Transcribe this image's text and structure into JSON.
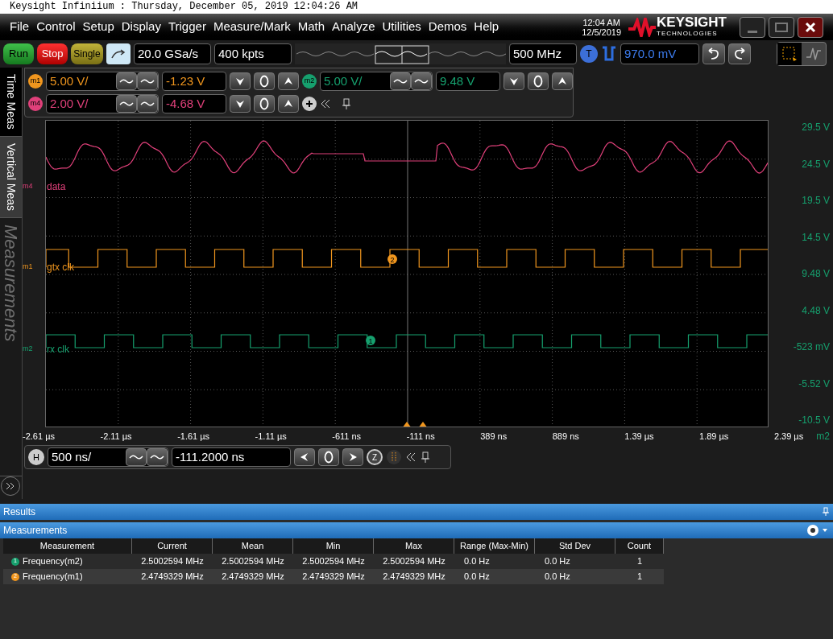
{
  "window": {
    "title": "Keysight Infiniium : Thursday, December 05, 2019 12:04:26 AM"
  },
  "menu": [
    "File",
    "Control",
    "Setup",
    "Display",
    "Trigger",
    "Measure/Mark",
    "Math",
    "Analyze",
    "Utilities",
    "Demos",
    "Help"
  ],
  "clock": {
    "time": "12:04 AM",
    "date": "12/5/2019"
  },
  "logo": {
    "name": "KEYSIGHT",
    "sub": "TECHNOLOGIES"
  },
  "window_buttons": [
    {
      "kind": "minimize"
    },
    {
      "kind": "restore"
    },
    {
      "kind": "close"
    }
  ],
  "toolbar": {
    "run": "Run",
    "stop": "Stop",
    "single": "Single",
    "sample_rate": "20.0 GSa/s",
    "memory": "400 kpts",
    "bandwidth": "500 MHz",
    "trigger_badge": "T",
    "trigger_level": "970.0 mV"
  },
  "channels": [
    {
      "badge": "m1",
      "color": "#f0961e",
      "scale": "5.00 V/",
      "offset": "-1.23 V"
    },
    {
      "badge": "m2",
      "color": "#16a06e",
      "scale": "5.00 V/",
      "offset": "9.48 V"
    },
    {
      "badge": "m4",
      "color": "#e0407a",
      "scale": "2.00 V/",
      "offset": "-4.68 V"
    }
  ],
  "side_tabs": [
    {
      "label": "Time Meas",
      "selected": true,
      "disabled": false
    },
    {
      "label": "Vertical Meas",
      "selected": false,
      "disabled": false
    },
    {
      "label": "Measurements",
      "selected": false,
      "disabled": true
    }
  ],
  "traces": [
    {
      "marker": "m4",
      "label": "data",
      "color": "#e0407a",
      "kind": "analog"
    },
    {
      "marker": "m1",
      "label": "gtx clk",
      "color": "#f0961e",
      "kind": "clock"
    },
    {
      "marker": "m2",
      "label": "rx clk",
      "color": "#16a06e",
      "kind": "clock"
    }
  ],
  "trace_markers": [
    {
      "label": "2",
      "color": "#f0961e"
    },
    {
      "label": "1",
      "color": "#16a06e"
    }
  ],
  "y_labels": [
    "29.5 V",
    "24.5 V",
    "19.5 V",
    "14.5 V",
    "9.48 V",
    "4.48 V",
    "-523 mV",
    "-5.52 V",
    "-10.5 V"
  ],
  "x_labels": [
    "-2.61 µs",
    "-2.11 µs",
    "-1.61 µs",
    "-1.11 µs",
    "-611 ns",
    "-111 ns",
    "389 ns",
    "889 ns",
    "1.39 µs",
    "1.89 µs",
    "2.39 µs"
  ],
  "x_source": "m2",
  "horizontal": {
    "badge": "H",
    "scale": "500 ns/",
    "position": "-111.2000 ns",
    "zoom_badge": "Z"
  },
  "results": {
    "title": "Results",
    "panel_title": "Measurements",
    "columns": [
      "Measurement",
      "Current",
      "Mean",
      "Min",
      "Max",
      "Range (Max-Min)",
      "Std Dev",
      "Count"
    ],
    "rows": [
      {
        "marker": "1",
        "color": "#16a06e",
        "cells": [
          "Frequency(m2)",
          "2.5002594 MHz",
          "2.5002594 MHz",
          "2.5002594 MHz",
          "2.5002594 MHz",
          "0.0 Hz",
          "0.0 Hz",
          "1"
        ]
      },
      {
        "marker": "2",
        "color": "#f0961e",
        "cells": [
          "Frequency(m1)",
          "2.4749329 MHz",
          "2.4749329 MHz",
          "2.4749329 MHz",
          "2.4749329 MHz",
          "0.0 Hz",
          "0.0 Hz",
          "1"
        ]
      }
    ]
  }
}
